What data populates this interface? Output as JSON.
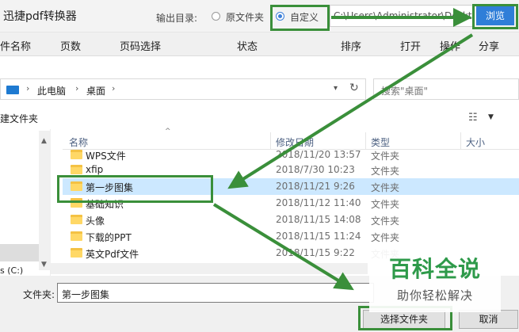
{
  "app": {
    "title": "迅捷pdf转换器",
    "output_label": "输出目录:",
    "radio_original": "原文件夹",
    "radio_custom": "自定义",
    "output_path": "C:\\Users\\Administrator\\Deskto",
    "browse_label": "浏览"
  },
  "columns": [
    "件名称",
    "页数",
    "页码选择",
    "状态",
    "排序",
    "打开",
    "操作",
    "分享"
  ],
  "dialog": {
    "breadcrumb": [
      "此电脑",
      "桌面"
    ],
    "search_placeholder": "搜索\"桌面\"",
    "new_folder": "建文件夹",
    "headers": {
      "name": "名称",
      "date": "修改日期",
      "type": "类型",
      "size": "大小"
    },
    "files": [
      {
        "name": "WPS文件",
        "date": "2018/11/20 13:57",
        "type": "文件夹",
        "selected": false
      },
      {
        "name": "xfip",
        "date": "2018/7/30 10:23",
        "type": "文件夹",
        "selected": false
      },
      {
        "name": "第一步图集",
        "date": "2018/11/21 9:26",
        "type": "文件夹",
        "selected": true
      },
      {
        "name": "基础知识",
        "date": "2018/11/12 11:40",
        "type": "文件夹",
        "selected": false
      },
      {
        "name": "头像",
        "date": "2018/11/15 14:08",
        "type": "文件夹",
        "selected": false
      },
      {
        "name": "下载的PPT",
        "date": "2018/11/15 11:24",
        "type": "文件夹",
        "selected": false
      },
      {
        "name": "英文Pdf文件",
        "date": "2018/11/15 9:22",
        "type": "文件夹",
        "selected": false
      }
    ],
    "drive_label": "s (C:)",
    "folder_label": "文件夹:",
    "folder_value": "第一步图集",
    "select_button": "选择文件夹",
    "cancel_button": "取消"
  },
  "watermark": {
    "title": "百科全说",
    "subtitle": "助你轻松解决"
  },
  "colors": {
    "accent_blue": "#2f7ed8",
    "highlight_green": "#3a8f3a",
    "selection": "#cce8ff"
  }
}
